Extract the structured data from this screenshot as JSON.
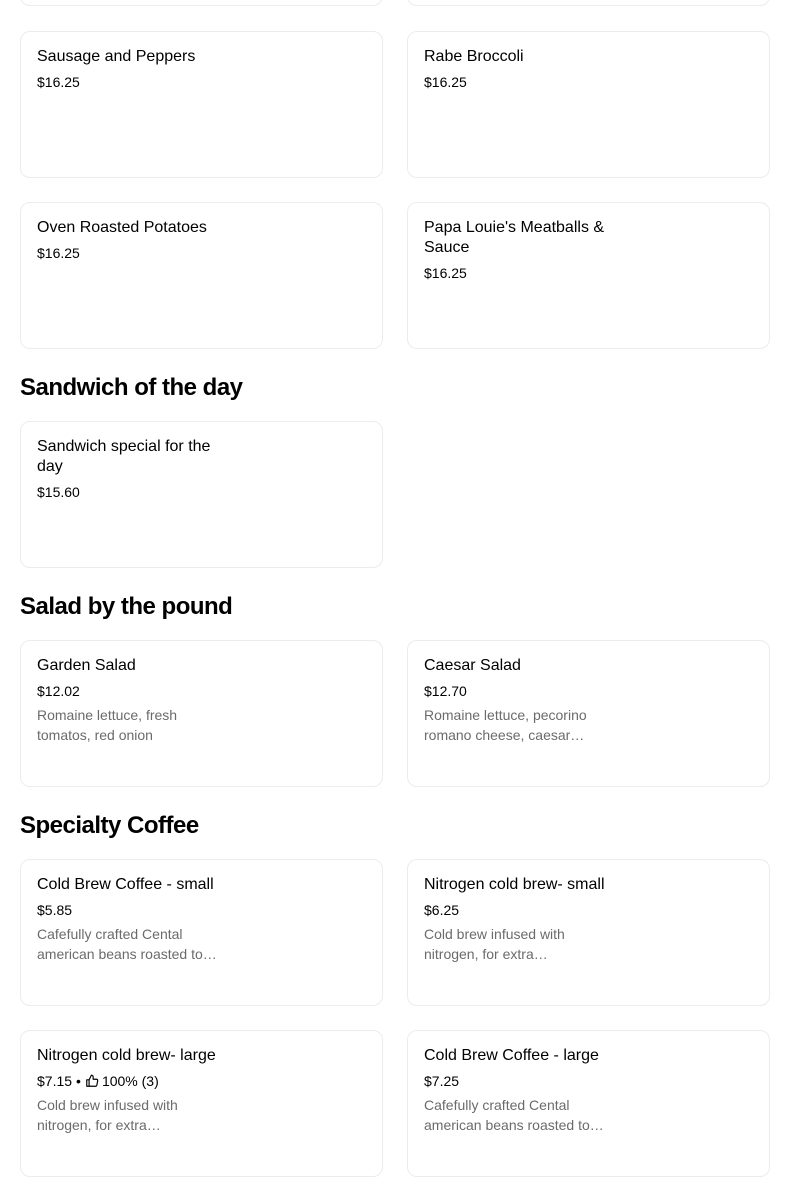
{
  "top_items": [
    {
      "name": "Sausage and Peppers",
      "price": "$16.25"
    },
    {
      "name": "Rabe Broccoli",
      "price": "$16.25"
    },
    {
      "name": "Oven Roasted Potatoes",
      "price": "$16.25"
    },
    {
      "name": "Papa Louie's Meatballs & Sauce",
      "price": "$16.25"
    }
  ],
  "sections": [
    {
      "title": "Sandwich of the day",
      "items": [
        {
          "name": "Sandwich special for the day",
          "price": "$15.60"
        }
      ]
    },
    {
      "title": "Salad by the pound",
      "items": [
        {
          "name": "Garden Salad",
          "price": "$12.02",
          "description": "Romaine lettuce, fresh tomatos, red onion"
        },
        {
          "name": "Caesar Salad",
          "price": "$12.70",
          "description": "Romaine lettuce, pecorino romano cheese, caesar…"
        }
      ]
    },
    {
      "title": "Specialty Coffee",
      "items": [
        {
          "name": "Cold Brew Coffee - small",
          "price": "$5.85",
          "description": "Cafefully crafted Cental american beans roasted to…"
        },
        {
          "name": "Nitrogen cold brew- small",
          "price": "$6.25",
          "description": "Cold brew infused with nitrogen, for extra…"
        },
        {
          "name": "Nitrogen cold brew- large",
          "price": "$7.15",
          "separator": "•",
          "rating": "100% (3)",
          "rating_icon": "thumbs-up-icon",
          "description": "Cold brew infused with nitrogen, for extra…"
        },
        {
          "name": "Cold Brew Coffee - large",
          "price": "$7.25",
          "description": "Cafefully crafted Cental american beans roasted to…"
        }
      ]
    }
  ],
  "colors": {
    "text": "#000000",
    "description": "#6b6b6b",
    "card_border": "#ececec",
    "background": "#ffffff"
  }
}
